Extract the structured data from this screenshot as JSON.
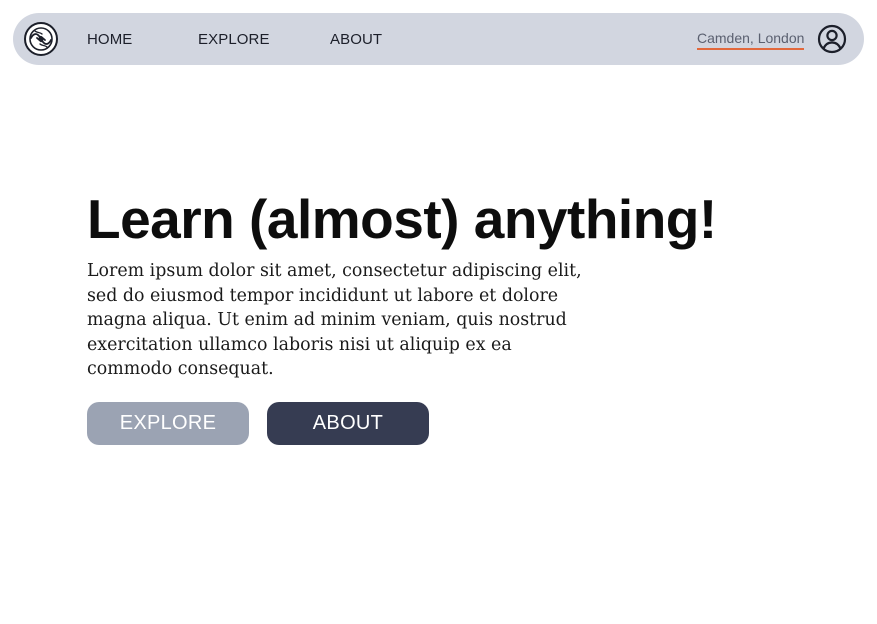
{
  "nav": {
    "links": [
      "HOME",
      "EXPLORE",
      "ABOUT"
    ],
    "location": "Camden, London",
    "logo_icon": "globe-handshake-icon",
    "account_icon": "user-circle-icon"
  },
  "hero": {
    "title": "Learn (almost) anything!",
    "lines": [
      "Lorem ipsum dolor sit amet, consectetur adipiscing elit,",
      "sed do eiusmod tempor incididunt ut labore et dolore",
      "magna aliqua. Ut enim ad minim veniam, quis nostrud",
      "exercitation ullamco laboris nisi ut aliquip ex ea",
      "commodo consequat."
    ]
  },
  "buttons": {
    "explore": "EXPLORE",
    "about": "ABOUT"
  },
  "colors": {
    "navbar_bg": "#d2d6e0",
    "location_underline": "#e2683c",
    "explore_button": "#9ba3b3",
    "about_button": "#363c52"
  }
}
